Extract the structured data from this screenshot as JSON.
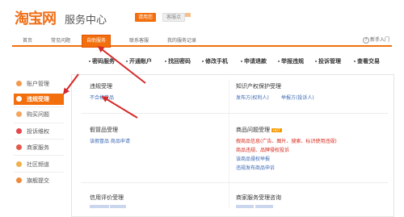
{
  "header": {
    "logo_text": "淘宝网",
    "service_title": "服务中心",
    "btn_orange": "请用您",
    "btn_gray": "客服点"
  },
  "nav": {
    "items": [
      "首页",
      "常见问题",
      "自助服务",
      "联系客服",
      "我的服务记录"
    ],
    "active_index": 2,
    "help_label": "新手入门"
  },
  "quick_links": [
    "密码服务",
    "开通账户",
    "找回密码",
    "修改手机",
    "申请退款",
    "举报违规",
    "投诉管理",
    "查看交易"
  ],
  "sidebar": {
    "items": [
      {
        "label": "账户管理",
        "icon": "user-icon"
      },
      {
        "label": "违规受理",
        "icon": "warning-icon",
        "active": true
      },
      {
        "label": "购买问题",
        "icon": "cart-icon"
      },
      {
        "label": "投诉维权",
        "icon": "shield-icon"
      },
      {
        "label": "商家服务",
        "icon": "shop-icon"
      },
      {
        "label": "社区频道",
        "icon": "community-icon"
      },
      {
        "label": "旗舰提交",
        "icon": "flag-icon"
      }
    ]
  },
  "sections": {
    "violation": {
      "title": "违规受理",
      "links": [
        "不合格货品"
      ]
    },
    "ip": {
      "title": "知识产权保护受理",
      "links": [
        "发布方(权利人)",
        "举报方(投诉人)"
      ]
    },
    "fake": {
      "title": "假冒品受理",
      "links": [
        "该假冒品 商品申请"
      ]
    },
    "goods": {
      "title": "商品问题受理",
      "badge": "HOT",
      "links": [
        "假商品信息(广告、图片、搜索、标识使用违规)",
        "商品违规、品牌侵权投诉",
        "该商品侵权举报",
        "违规发布商品申诉"
      ]
    },
    "credit": {
      "title": "信用评价受理"
    },
    "merchant": {
      "title": "商家服务受理咨询"
    }
  },
  "colors": {
    "brand_orange": "#f36f0d",
    "logo_orange": "#f06e17",
    "link_blue": "#3a68b4",
    "alert_red": "#d7281b",
    "annotation_red": "#d42a2a"
  }
}
